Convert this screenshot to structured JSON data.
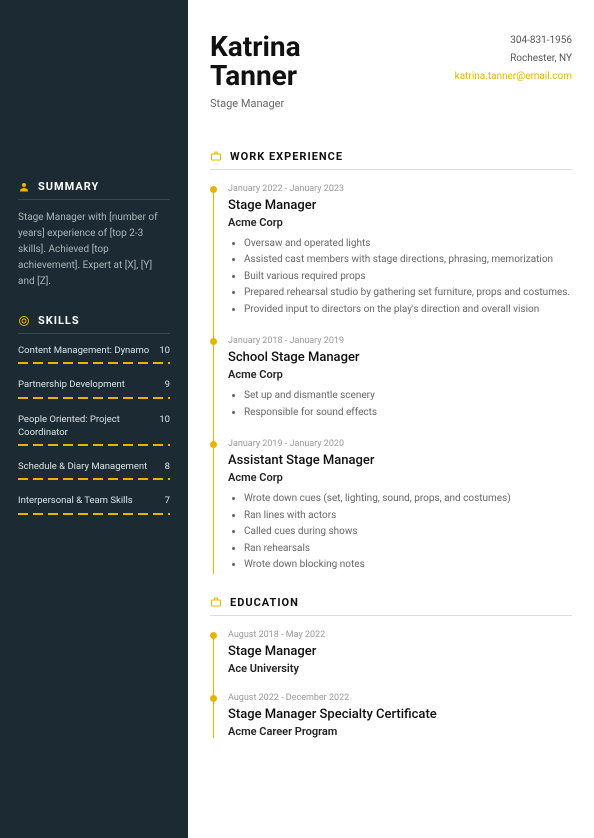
{
  "name": "Katrina Tanner",
  "role": "Stage Manager",
  "contact": {
    "phone": "304-831-1956",
    "location": "Rochester, NY",
    "email": "katrina.tanner@email.com"
  },
  "summary": {
    "heading": "SUMMARY",
    "text": "Stage Manager with [number of years] experience of [top 2-3 skills]. Achieved [top achievement]. Expert at [X], [Y] and [Z]."
  },
  "skills": {
    "heading": "SKILLS",
    "items": [
      {
        "name": "Content Management: Dynamo",
        "score": "10"
      },
      {
        "name": "Partnership Development",
        "score": "9"
      },
      {
        "name": "People Oriented: Project Coordinator",
        "score": "10"
      },
      {
        "name": "Schedule & Diary Management",
        "score": "8"
      },
      {
        "name": "Interpersonal & Team Skills",
        "score": "7"
      }
    ]
  },
  "work": {
    "heading": "WORK EXPERIENCE",
    "entries": [
      {
        "dates": "January 2022 - January 2023",
        "title": "Stage Manager",
        "company": "Acme Corp",
        "bullets": [
          "Oversaw and operated lights",
          "Assisted cast members with stage directions, phrasing, memorization",
          "Built various required props",
          "Prepared rehearsal studio by gathering set furniture, props and costumes.",
          "Provided input to directors on the play's direction and overall vision"
        ]
      },
      {
        "dates": "January 2018 - January 2019",
        "title": "School Stage Manager",
        "company": "Acme Corp",
        "bullets": [
          "Set up and dismantle scenery",
          "Responsible for sound effects"
        ]
      },
      {
        "dates": "January 2019 - January 2020",
        "title": "Assistant Stage Manager",
        "company": "Acme Corp",
        "bullets": [
          "Wrote down cues (set, lighting, sound, props, and costumes)",
          "Ran lines with actors",
          "Called cues during shows",
          "Ran rehearsals",
          "Wrote down blocking notes"
        ]
      }
    ]
  },
  "education": {
    "heading": "EDUCATION",
    "entries": [
      {
        "dates": "August 2018 - May 2022",
        "title": "Stage Manager",
        "school": "Ace University"
      },
      {
        "dates": "August 2022 - December 2022",
        "title": "Stage Manager Specialty Certificate",
        "school": "Acme Career Program"
      }
    ]
  }
}
